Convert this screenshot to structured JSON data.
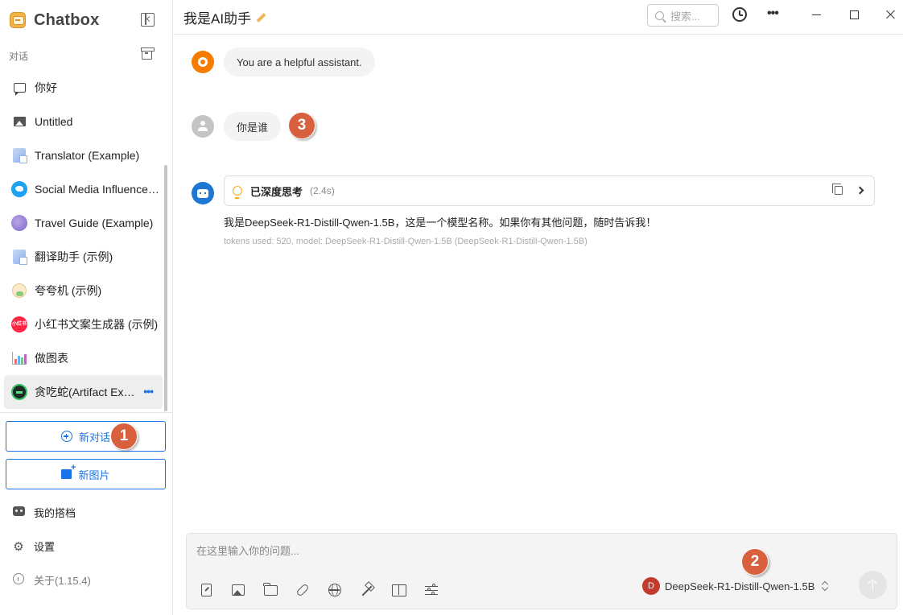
{
  "app": {
    "name": "Chatbox"
  },
  "sidebar": {
    "section_label": "对话",
    "conversations": [
      {
        "label": "你好",
        "icon": "chat-bubble-icon"
      },
      {
        "label": "Untitled",
        "icon": "image-icon"
      },
      {
        "label": "Translator (Example)",
        "icon": "translator-avatar"
      },
      {
        "label": "Social Media Influencer (Example)",
        "icon": "twitter-avatar"
      },
      {
        "label": "Travel Guide (Example)",
        "icon": "globe-avatar"
      },
      {
        "label": "翻译助手 (示例)",
        "icon": "translator-avatar"
      },
      {
        "label": "夸夸机 (示例)",
        "icon": "praise-bot-avatar"
      },
      {
        "label": "小红书文案生成器 (示例)",
        "icon": "xiaohongshu-avatar",
        "badge_text": "小红书"
      },
      {
        "label": "做图表",
        "icon": "chart-avatar"
      },
      {
        "label": "贪吃蛇(Artifact Example)",
        "icon": "snake-game-avatar",
        "active": true
      }
    ],
    "new_chat_label": "新对话",
    "new_image_label": "新图片",
    "my_bots_label": "我的搭档",
    "settings_label": "设置",
    "about_label": "关于(1.15.4)"
  },
  "header": {
    "title": "我是AI助手",
    "search_placeholder": "搜索..."
  },
  "messages": [
    {
      "role": "system",
      "text": "You are a helpful assistant."
    },
    {
      "role": "user",
      "text": "你是谁"
    },
    {
      "role": "assistant",
      "thinking_label": "已深度思考",
      "thinking_time": "(2.4s)",
      "text": "我是DeepSeek-R1-Distill-Qwen-1.5B，这是一个模型名称。如果你有其他问题，随时告诉我！",
      "meta": "tokens used: 520, model: DeepSeek-R1-Distill-Qwen-1.5B (DeepSeek-R1-Distill-Qwen-1.5B)"
    }
  ],
  "input": {
    "placeholder": "在这里输入你的问题...",
    "model_initial": "D",
    "model_name": "DeepSeek-R1-Distill-Qwen-1.5B"
  },
  "annotations": [
    "1",
    "2",
    "3"
  ],
  "colors": {
    "accent": "#1a73e8",
    "badge": "#d9603f",
    "system_avatar": "#f57c00",
    "assistant_avatar": "#1e77d3",
    "model_avatar": "#c33a2e"
  }
}
